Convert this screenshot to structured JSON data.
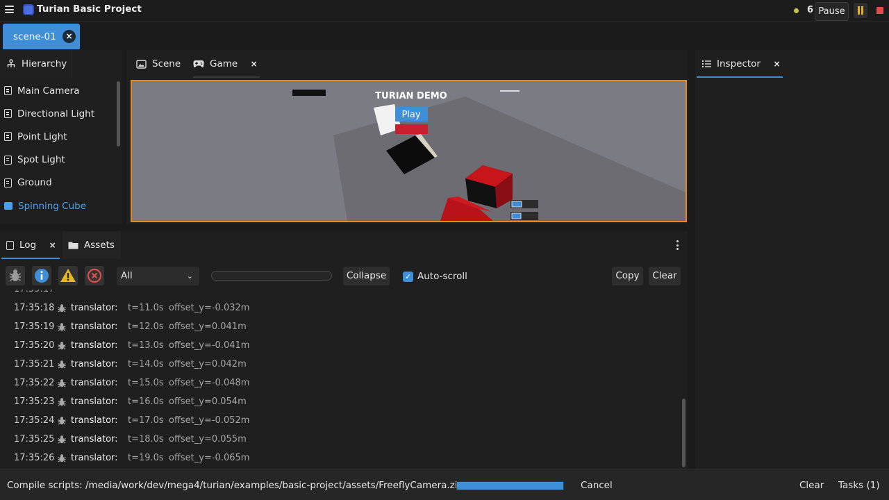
{
  "app": {
    "title": "Turian Basic Project",
    "status_count": "6",
    "pause_label": "Pause",
    "colors": {
      "accent": "#3f8fd8",
      "viewport_border": "#e58a1f",
      "stop": "#e04d4d",
      "pause": "#e0b030"
    }
  },
  "scene_tab": {
    "label": "scene-01",
    "close": "×"
  },
  "hierarchy": {
    "tab_label": "Hierarchy",
    "items": [
      {
        "label": "Main Camera"
      },
      {
        "label": "Directional Light"
      },
      {
        "label": "Point Light"
      },
      {
        "label": "Spot Light"
      },
      {
        "label": "Ground"
      },
      {
        "label": "Spinning Cube",
        "selected": true
      }
    ]
  },
  "view_tabs": {
    "scene": "Scene",
    "game": "Game",
    "close": "×"
  },
  "game": {
    "title": "TURIAN DEMO",
    "play_label": "Play"
  },
  "inspector": {
    "tab_label": "Inspector",
    "close": "×"
  },
  "log": {
    "tab_label": "Log",
    "assets_label": "Assets",
    "close": "×",
    "filter": {
      "selected": "All"
    },
    "collapse_label": "Collapse",
    "autoscroll_label": "Auto-scroll",
    "autoscroll_checked": true,
    "copy_label": "Copy",
    "clear_label": "Clear",
    "lines": [
      {
        "time": "17:35:18",
        "source": "translator:",
        "t": "t=11.0s",
        "msg": "offset_y=-0.032m"
      },
      {
        "time": "17:35:19",
        "source": "translator:",
        "t": "t=12.0s",
        "msg": "offset_y=0.041m"
      },
      {
        "time": "17:35:20",
        "source": "translator:",
        "t": "t=13.0s",
        "msg": "offset_y=-0.041m"
      },
      {
        "time": "17:35:21",
        "source": "translator:",
        "t": "t=14.0s",
        "msg": "offset_y=0.042m"
      },
      {
        "time": "17:35:22",
        "source": "translator:",
        "t": "t=15.0s",
        "msg": "offset_y=-0.048m"
      },
      {
        "time": "17:35:23",
        "source": "translator:",
        "t": "t=16.0s",
        "msg": "offset_y=0.054m"
      },
      {
        "time": "17:35:24",
        "source": "translator:",
        "t": "t=17.0s",
        "msg": "offset_y=-0.052m"
      },
      {
        "time": "17:35:25",
        "source": "translator:",
        "t": "t=18.0s",
        "msg": "offset_y=0.055m"
      },
      {
        "time": "17:35:26",
        "source": "translator:",
        "t": "t=19.0s",
        "msg": "offset_y=-0.065m"
      }
    ]
  },
  "statusbar": {
    "text": "Compile scripts: /media/work/dev/mega4/turian/examples/basic-project/assets/FreeflyCamera.zig",
    "progress": 1.0,
    "cancel_label": "Cancel",
    "clear_label": "Clear",
    "tasks_label": "Tasks (1)"
  }
}
